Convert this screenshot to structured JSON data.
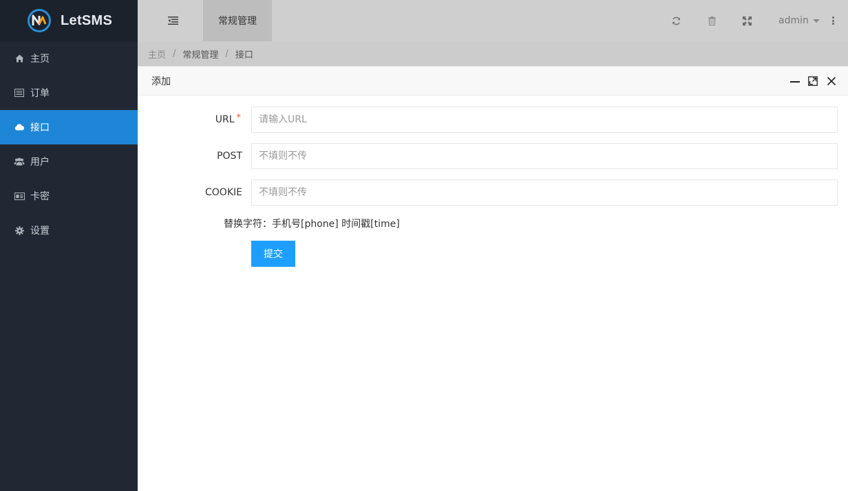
{
  "brand": {
    "name": "LetSMS"
  },
  "sidebar": {
    "items": [
      {
        "label": "主页",
        "icon": "home-icon"
      },
      {
        "label": "订单",
        "icon": "list-icon"
      },
      {
        "label": "接口",
        "icon": "cloud-icon",
        "active": true
      },
      {
        "label": "用户",
        "icon": "users-icon"
      },
      {
        "label": "卡密",
        "icon": "card-icon"
      },
      {
        "label": "设置",
        "icon": "gear-icon"
      }
    ]
  },
  "header": {
    "tab": "常规管理",
    "user": "admin",
    "icons": [
      "menu-toggle-icon",
      "refresh-icon",
      "trash-icon",
      "fullscreen-icon",
      "more-vertical-icon"
    ]
  },
  "breadcrumb": [
    "主页",
    "常规管理",
    "接口"
  ],
  "dialog": {
    "title": "添加",
    "fields": [
      {
        "label": "URL",
        "required": "*",
        "placeholder": "请输入URL",
        "value": ""
      },
      {
        "label": "POST",
        "placeholder": "不填则不传",
        "value": ""
      },
      {
        "label": "COOKIE",
        "placeholder": "不填则不传",
        "value": ""
      }
    ],
    "hint": "替换字符：手机号[phone] 时间戳[time]",
    "submit": "提交"
  },
  "colors": {
    "sidebar_bg": "#212833",
    "active_item": "#1e86d6",
    "primary_button": "#1e9fff",
    "required_mark": "#ff5722"
  }
}
